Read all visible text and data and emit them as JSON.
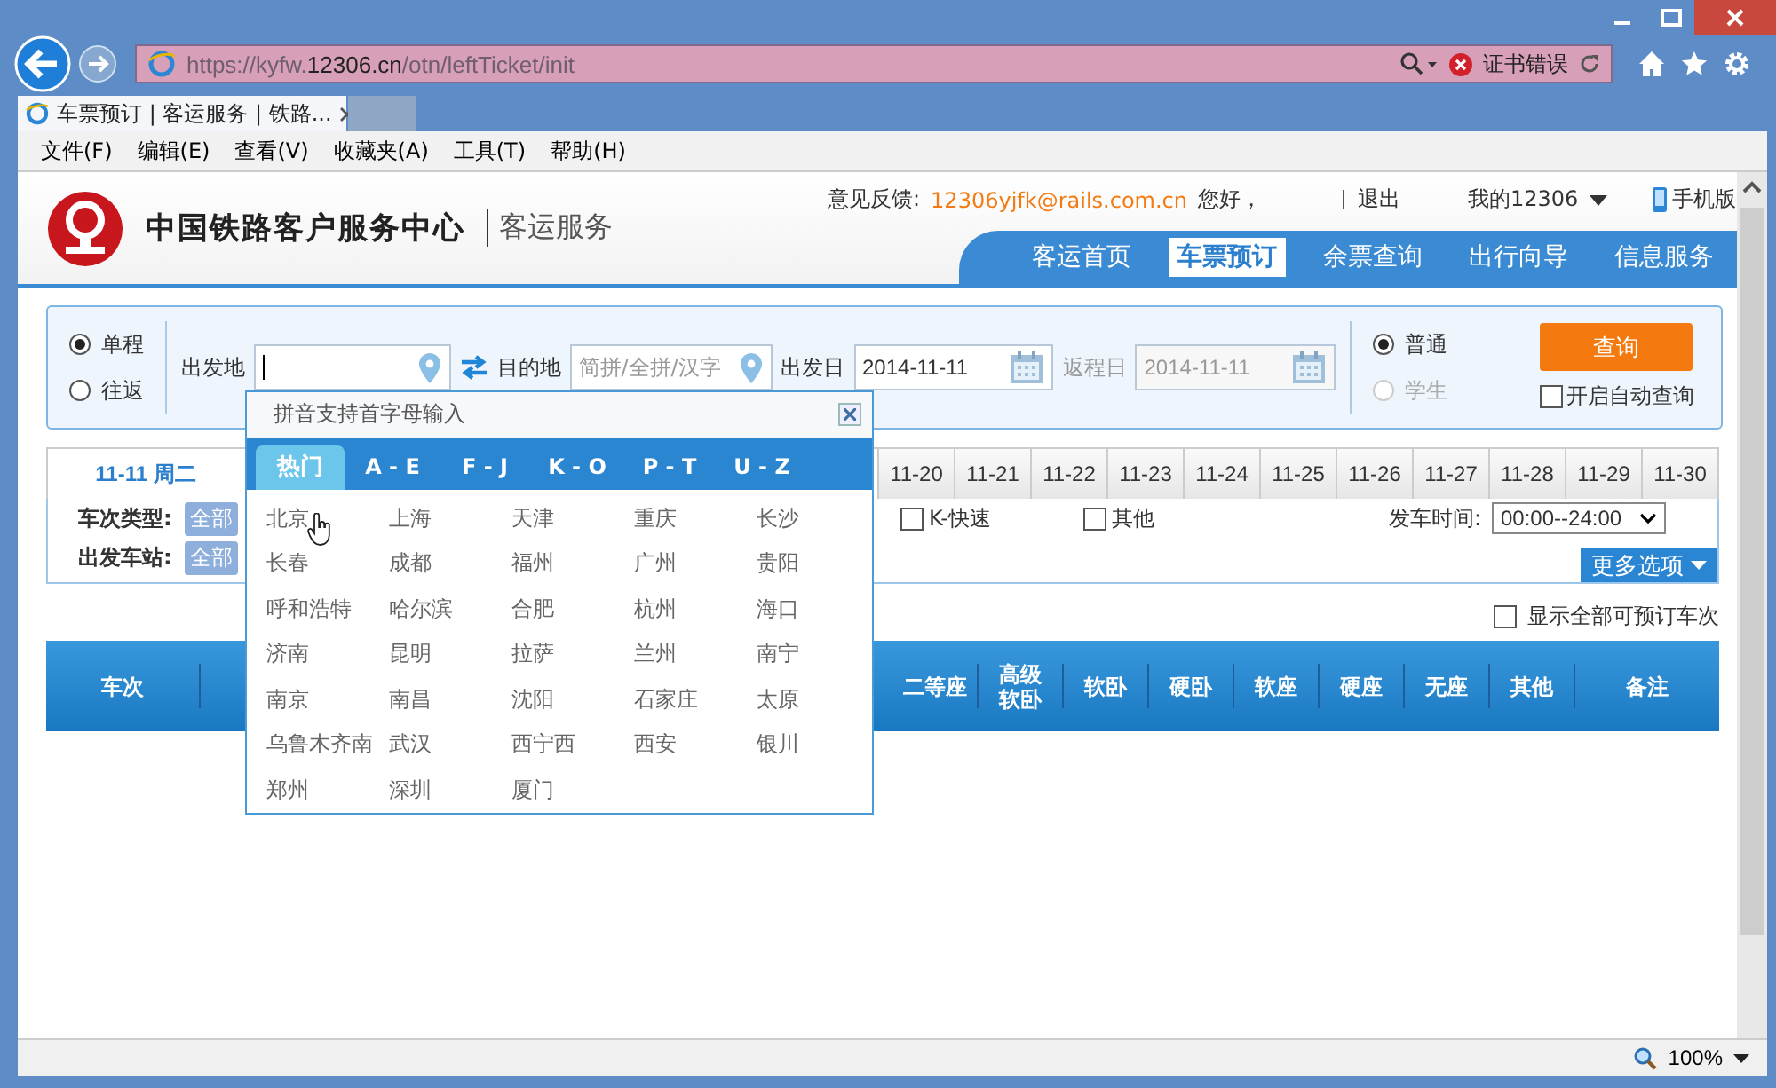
{
  "browser": {
    "address": {
      "prefix": "https://kyfw.",
      "domain": "12306.cn",
      "path": "/otn/leftTicket/init"
    },
    "cert_error": "证书错误",
    "tabs": [
      {
        "title": "车票预订 | 客运服务 | 铁路...",
        "selected": true
      }
    ],
    "menu": [
      "文件(F)",
      "编辑(E)",
      "查看(V)",
      "收藏夹(A)",
      "工具(T)",
      "帮助(H)"
    ]
  },
  "header": {
    "logo_text": "中国铁路客户服务中心",
    "logo_sub": "客运服务",
    "feedback_label": "意见反馈:",
    "feedback_email": "12306yjfk@rails.com.cn",
    "greeting": "您好，",
    "logout": "退出",
    "my_account": "我的12306",
    "mobile": "手机版",
    "nav": [
      {
        "label": "客运首页",
        "selected": false
      },
      {
        "label": "车票预订",
        "selected": true
      },
      {
        "label": "余票查询",
        "selected": false
      },
      {
        "label": "出行向导",
        "selected": false
      },
      {
        "label": "信息服务",
        "selected": false
      }
    ]
  },
  "search": {
    "trip_types": [
      {
        "label": "单程",
        "selected": true
      },
      {
        "label": "往返",
        "selected": false
      }
    ],
    "from_label": "出发地",
    "to_label": "目的地",
    "to_placeholder": "简拼/全拼/汉字",
    "date_label": "出发日",
    "date_value": "2014-11-11",
    "return_label": "返程日",
    "return_value": "2014-11-11",
    "return_disabled": true,
    "passenger_types": [
      {
        "label": "普通",
        "selected": true,
        "disabled": false
      },
      {
        "label": "学生",
        "selected": false,
        "disabled": true
      }
    ],
    "query_button": "查询",
    "auto_query": {
      "label": "开启自动查询",
      "checked": false
    }
  },
  "dates": [
    {
      "label": "11-11 周二",
      "selected": true
    },
    {
      "label": "11-20",
      "selected": false
    },
    {
      "label": "11-21",
      "selected": false
    },
    {
      "label": "11-22",
      "selected": false
    },
    {
      "label": "11-23",
      "selected": false
    },
    {
      "label": "11-24",
      "selected": false
    },
    {
      "label": "11-25",
      "selected": false
    },
    {
      "label": "11-26",
      "selected": false
    },
    {
      "label": "11-27",
      "selected": false
    },
    {
      "label": "11-28",
      "selected": false
    },
    {
      "label": "11-29",
      "selected": false
    },
    {
      "label": "11-30",
      "selected": false
    }
  ],
  "filters": {
    "train_type_label": "车次类型:",
    "train_type_all": "全部",
    "station_label": "出发车站:",
    "station_all": "全部",
    "train_types": [
      {
        "label": "K-快速",
        "checked": false
      },
      {
        "label": "其他",
        "checked": false
      }
    ],
    "time_label": "发车时间:",
    "time_value": "00:00--24:00",
    "more_button": "更多选项"
  },
  "show_all": {
    "label": "显示全部可预订车次",
    "checked": false
  },
  "table": {
    "columns": [
      "车次",
      "二等座",
      "高级软卧",
      "软卧",
      "硬卧",
      "软座",
      "硬座",
      "无座",
      "其他",
      "备注"
    ]
  },
  "popup": {
    "hint": "拼音支持首字母输入",
    "tabs": [
      {
        "label": "热门",
        "selected": true
      },
      {
        "label": "A - E",
        "selected": false
      },
      {
        "label": "F - J",
        "selected": false
      },
      {
        "label": "K - O",
        "selected": false
      },
      {
        "label": "P - T",
        "selected": false
      },
      {
        "label": "U - Z",
        "selected": false
      }
    ],
    "cities": [
      "北京",
      "上海",
      "天津",
      "重庆",
      "长沙",
      "长春",
      "成都",
      "福州",
      "广州",
      "贵阳",
      "呼和浩特",
      "哈尔滨",
      "合肥",
      "杭州",
      "海口",
      "济南",
      "昆明",
      "拉萨",
      "兰州",
      "南宁",
      "南京",
      "南昌",
      "沈阳",
      "石家庄",
      "太原",
      "乌鲁木齐南",
      "武汉",
      "西宁西",
      "西安",
      "银川",
      "郑州",
      "深圳",
      "厦门"
    ]
  },
  "status_bar": {
    "zoom": "100%"
  }
}
